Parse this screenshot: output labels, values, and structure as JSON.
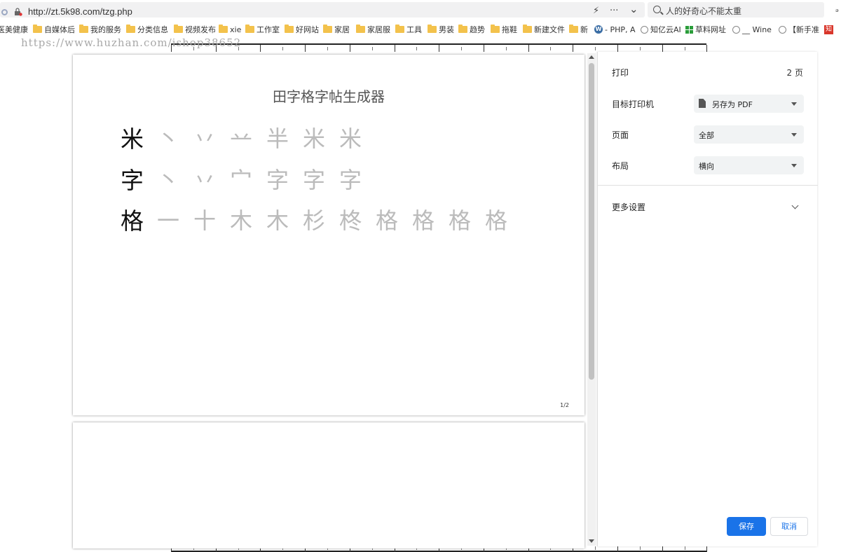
{
  "browser": {
    "url": "http://zt.5k98.com/tzg.php",
    "search_text": "人的好奇心不能太重",
    "tools": {
      "lightning": "⚡",
      "more": "···",
      "dropdown": "⌄"
    }
  },
  "bookmarks": [
    {
      "label": "医美健康",
      "icon": "none"
    },
    {
      "label": "自媒体后",
      "icon": "folder"
    },
    {
      "label": "我的服务",
      "icon": "folder"
    },
    {
      "label": "分类信息",
      "icon": "folder"
    },
    {
      "label": "视频发布",
      "icon": "folder"
    },
    {
      "label": "xie",
      "icon": "folder"
    },
    {
      "label": "工作室",
      "icon": "folder"
    },
    {
      "label": "好网站",
      "icon": "folder"
    },
    {
      "label": "家居",
      "icon": "folder"
    },
    {
      "label": "家居服",
      "icon": "folder"
    },
    {
      "label": "工具",
      "icon": "folder"
    },
    {
      "label": "男装",
      "icon": "folder"
    },
    {
      "label": "趋势",
      "icon": "folder"
    },
    {
      "label": "拖鞋",
      "icon": "folder"
    },
    {
      "label": "新建文件",
      "icon": "folder"
    },
    {
      "label": "新",
      "icon": "folder"
    },
    {
      "label": "- PHP, A",
      "icon": "wordpress"
    },
    {
      "label": "知亿云AI",
      "icon": "globe"
    },
    {
      "label": "草料网址",
      "icon": "grid"
    },
    {
      "label": "__ Wine",
      "icon": "globe"
    },
    {
      "label": "【新手准",
      "icon": "globe"
    },
    {
      "label": "",
      "icon": "red"
    }
  ],
  "watermark": "https://www.huzhan.com/ishop38652",
  "preview": {
    "title": "田字格字帖生成器",
    "rows": [
      {
        "char": "米",
        "strokes": [
          "丶",
          "丷",
          "䒑",
          "半",
          "米",
          "米"
        ]
      },
      {
        "char": "字",
        "strokes": [
          "丶",
          "丷",
          "宀",
          "字",
          "字",
          "字"
        ]
      },
      {
        "char": "格",
        "strokes": [
          "一",
          "十",
          "木",
          "木",
          "杉",
          "柊",
          "格",
          "格",
          "格",
          "格"
        ]
      }
    ],
    "page_num": "1/2"
  },
  "print_panel": {
    "title": "打印",
    "page_count": "2 页",
    "printer_label": "目标打印机",
    "printer_value": "另存为 PDF",
    "pages_label": "页面",
    "pages_value": "全部",
    "layout_label": "布局",
    "layout_value": "横向",
    "more_settings": "更多设置",
    "save": "保存",
    "cancel": "取消"
  }
}
